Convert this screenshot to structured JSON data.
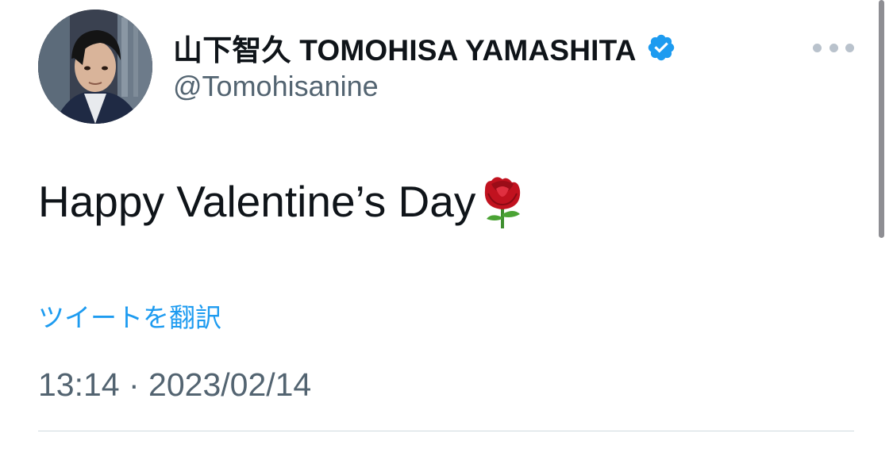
{
  "user": {
    "display_name": "山下智久 TOMOHISA YAMASHITA",
    "handle": "@Tomohisanine",
    "verified": true,
    "avatar_icon": "profile-photo"
  },
  "tweet": {
    "text": "Happy Valentine’s Day",
    "emoji": "rose",
    "translate_label": "ツイートを翻訳",
    "timestamp": "13:14 · 2023/02/14"
  },
  "colors": {
    "accent": "#1d9bf0",
    "text": "#0f1419",
    "secondary": "#536471",
    "divider": "#cfd9de"
  },
  "icons": {
    "more": "more-icon",
    "verified": "verified-badge-icon"
  }
}
